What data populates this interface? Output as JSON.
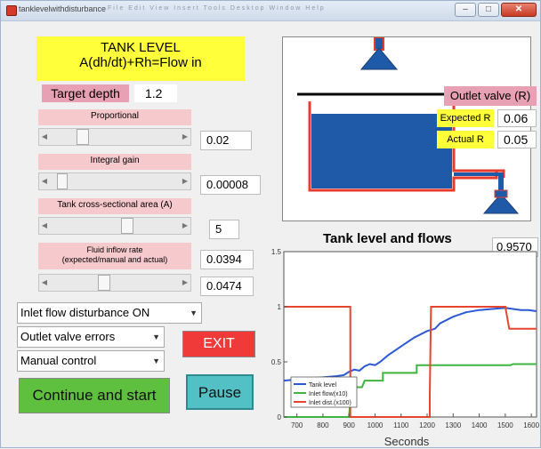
{
  "window": {
    "title": "tanklevelwithdisturbance",
    "menu_blur": "File  Edit  View  Insert  Tools  Desktop  Window  Help"
  },
  "header": {
    "line1": "TANK LEVEL",
    "line2": "A(dh/dt)+Rh=Flow in"
  },
  "target": {
    "label": "Target depth",
    "value": "1.2"
  },
  "sliders": [
    {
      "label": "Proportional",
      "value": "0.02",
      "fraction": 0.2
    },
    {
      "label": "Integral gain",
      "value": "0.00008",
      "fraction": 0.05
    },
    {
      "label": "Tank cross-sectional area (A)",
      "value": "5",
      "fraction": 0.55
    },
    {
      "label_line1": "Fluid inflow rate",
      "label_line2": "(expected/manual and actual)",
      "value_expected": "0.0394",
      "value_actual": "0.0474",
      "fraction": 0.4
    }
  ],
  "dropdowns": {
    "disturbance": "Inlet flow disturbance ON",
    "valve": "Outlet valve errors",
    "control": "Manual control"
  },
  "buttons": {
    "exit": "EXIT",
    "continue": "Continue and start",
    "pause": "Pause"
  },
  "tank": {
    "outlet_label": "Outlet valve (R)",
    "expected_r_label": "Expected R",
    "expected_r_value": "0.06",
    "actual_r_label": "Actual R",
    "actual_r_value": "0.05",
    "level_fraction": 0.75
  },
  "colors": {
    "tank_blue": "#1e5aa8",
    "wall_red": "#e83a2e",
    "accent_yellow": "#ffff3a",
    "pink_label": "#f6c9cc",
    "exit_red": "#f03a3a",
    "continue_green": "#5fbf3f",
    "pause_teal": "#53c0c6"
  },
  "chart_data": {
    "type": "line",
    "title": "Tank level and flows",
    "value_readout": "0.9570",
    "xlabel": "Seconds",
    "xlim": [
      650,
      1620
    ],
    "ylim": [
      0,
      1.5
    ],
    "xticks": [
      "700",
      "800",
      "900",
      "1000",
      "1100",
      "1200",
      "1300",
      "1400",
      "1500",
      "1600"
    ],
    "yticks": [
      "0",
      "0.5",
      "1",
      "1.5"
    ],
    "series": [
      {
        "name": "Tank level",
        "color": "#2b59d6",
        "points": [
          [
            650,
            0.33
          ],
          [
            700,
            0.34
          ],
          [
            750,
            0.35
          ],
          [
            800,
            0.36
          ],
          [
            850,
            0.37
          ],
          [
            880,
            0.38
          ],
          [
            900,
            0.41
          ],
          [
            920,
            0.43
          ],
          [
            940,
            0.42
          ],
          [
            960,
            0.46
          ],
          [
            980,
            0.48
          ],
          [
            1000,
            0.47
          ],
          [
            1020,
            0.5
          ],
          [
            1050,
            0.56
          ],
          [
            1100,
            0.64
          ],
          [
            1150,
            0.72
          ],
          [
            1200,
            0.78
          ],
          [
            1230,
            0.8
          ],
          [
            1250,
            0.85
          ],
          [
            1300,
            0.91
          ],
          [
            1350,
            0.95
          ],
          [
            1400,
            0.97
          ],
          [
            1450,
            0.98
          ],
          [
            1500,
            0.99
          ],
          [
            1530,
            0.98
          ],
          [
            1560,
            0.97
          ],
          [
            1590,
            0.97
          ],
          [
            1620,
            0.96
          ]
        ]
      },
      {
        "name": "Inlet flow(x10)",
        "color": "#3fb43f",
        "points": [
          [
            650,
            0
          ],
          [
            900,
            0
          ],
          [
            910,
            0.27
          ],
          [
            950,
            0.27
          ],
          [
            960,
            0.33
          ],
          [
            1030,
            0.33
          ],
          [
            1030,
            0.4
          ],
          [
            1160,
            0.4
          ],
          [
            1160,
            0.47
          ],
          [
            1520,
            0.47
          ],
          [
            1530,
            0.48
          ],
          [
            1620,
            0.48
          ]
        ]
      },
      {
        "name": "Inlet dist.(x100)",
        "color": "#e8452e",
        "points": [
          [
            650,
            1
          ],
          [
            905,
            1
          ],
          [
            905,
            0
          ],
          [
            1210,
            0
          ],
          [
            1210,
            0.2
          ],
          [
            1215,
            1
          ],
          [
            1500,
            1
          ],
          [
            1515,
            0.8
          ],
          [
            1620,
            0.8
          ]
        ]
      }
    ]
  }
}
